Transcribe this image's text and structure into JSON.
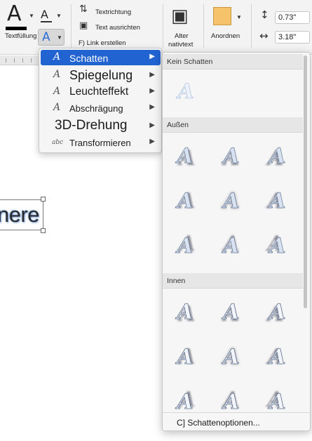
{
  "ribbon": {
    "textfill_label": "Textfüllung",
    "textdirection_label": "Textrichtung",
    "align_text_label": "Text ausrichten",
    "create_link_label": "F) Link erstellen",
    "alt_text_label_line1": "Alter",
    "alt_text_label_line2": "nativtext",
    "arrange_label": "Anordnen",
    "height_value": "0.73\"",
    "width_value": "3.18\""
  },
  "document": {
    "text_fragment": "nere"
  },
  "menu": {
    "items": [
      {
        "label": "Schatten",
        "icon": "text-shadow-icon",
        "active": true
      },
      {
        "label": "Spiegelung",
        "icon": "text-reflection-icon",
        "active": false
      },
      {
        "label": "Leuchteffekt",
        "icon": "text-glow-icon",
        "active": false
      },
      {
        "label": "Abschrägung",
        "icon": "text-bevel-icon",
        "active": false
      },
      {
        "label": "3D-Drehung",
        "icon": "text-3d-rotation-icon",
        "active": false
      },
      {
        "label": "Transformieren",
        "icon": "text-transform-icon",
        "active": false
      }
    ]
  },
  "gallery": {
    "section_none": "Kein Schatten",
    "section_outer": "Außen",
    "section_inner": "Innen",
    "footer_label": "C] Schattenoptionen..."
  },
  "colors": {
    "accent": "#2163d1",
    "menu_bg": "#f5f5f5",
    "ribbon_bg": "#f3f3f3"
  }
}
